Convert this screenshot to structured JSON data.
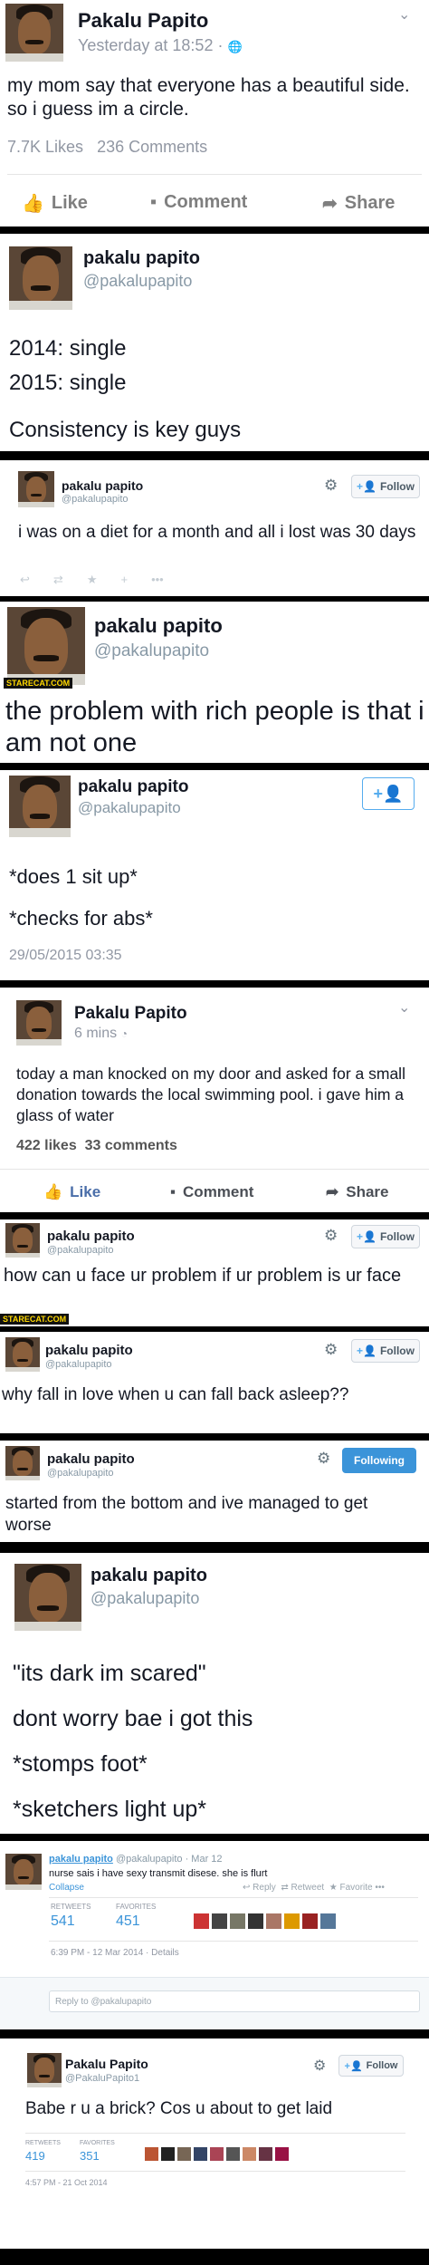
{
  "p1": {
    "name": "Pakalu Papito",
    "time": "Yesterday at 18:52 · ",
    "globe_icon": "🌐",
    "text": "my mom say that everyone has a beautiful side. so i guess im a circle.",
    "likes": "7.7K Likes",
    "comments": "236 Comments",
    "like_label": "Like",
    "comment_label": "Comment",
    "share_label": "Share"
  },
  "p2": {
    "name": "pakalu papito",
    "handle": "@pakalupapito",
    "line1": "2014: single",
    "line2": "2015: single",
    "line3": "Consistency is key guys"
  },
  "p3": {
    "name": "pakalu papito",
    "handle": "@pakalupapito",
    "follow_label": "Follow",
    "text": "i was on a diet for a month and all i lost was 30 days"
  },
  "p4": {
    "name": "pakalu papito",
    "handle": "@pakalupapito",
    "stamp": "STARECAT.COM",
    "text": "the problem with rich people is that i am not one"
  },
  "p5": {
    "name": "pakalu papito",
    "handle": "@pakalupapito",
    "line1": "*does 1 sit up*",
    "line2": "*checks for abs*",
    "date": "29/05/2015 03:35"
  },
  "p6": {
    "name": "Pakalu Papito",
    "time": "6 mins",
    "text": "today a man knocked on my door and asked for a small donation towards the local swimming pool. i gave him a glass of water",
    "likes": "422 likes",
    "comments": "33 comments",
    "like_label": "Like",
    "comment_label": "Comment",
    "share_label": "Share"
  },
  "p7": {
    "name": "pakalu papito",
    "handle": "@pakalupapito",
    "follow_label": "Follow",
    "text": "how can u face ur problem if ur problem is ur face",
    "stamp": "STARECAT.COM"
  },
  "p8": {
    "name": "pakalu papito",
    "handle": "@pakalupapito",
    "follow_label": "Follow",
    "text": "why fall in love when u can fall back asleep??"
  },
  "p9": {
    "name": "pakalu papito",
    "handle": "@pakalupapito",
    "following_label": "Following",
    "text": "started from the bottom and ive managed to get worse"
  },
  "p10": {
    "name": "pakalu papito",
    "handle": "@pakalupapito",
    "line1": "\"its dark im scared\"",
    "line2": "dont worry bae i got this",
    "line3": "*stomps foot*",
    "line4": "*sketchers light up*"
  },
  "p11": {
    "name": "pakalu papito",
    "handle": "@pakalupapito · Mar 12",
    "text": "nurse sais i have sexy transmit disese. she is flurt",
    "collapse": "Collapse",
    "reply": "Reply",
    "retweet": "Retweet",
    "favorite": "Favorite",
    "more": "•••",
    "retweets_label": "RETWEETS",
    "retweets": "541",
    "favorites_label": "FAVORITES",
    "favorites": "451",
    "date": "6:39 PM - 12 Mar 2014 · Details",
    "reply_placeholder": "Reply to @pakalupapito"
  },
  "p12": {
    "name": "Pakalu Papito",
    "handle": "@PakaluPapito1",
    "follow_label": "Follow",
    "text": "Babe r u a brick? Cos u about to get laid",
    "retweets_label": "RETWEETS",
    "retweets": "419",
    "favorites_label": "FAVORITES",
    "favorites": "351",
    "date": "4:57 PM - 21 Oct 2014"
  },
  "colors": {
    "fb_blue": "#4a6ea9",
    "twitter_blue": "#55acee",
    "link_blue": "#3b94d9",
    "muted": "#9197a3"
  }
}
